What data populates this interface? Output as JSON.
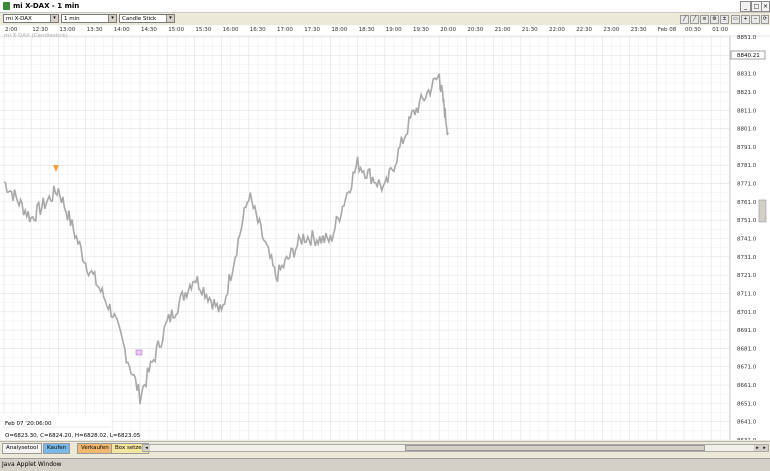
{
  "window": {
    "title": "mi X-DAX - 1 min",
    "java_status": "Java Applet Window"
  },
  "toolbar": {
    "instrument": "mi X-DAX",
    "interval": "1 min",
    "chart_type": "Candle Stick (Kerzen"
  },
  "chart": {
    "series_label": "mi X-DAX (Candlestick)",
    "last_price": "8840.21",
    "time_labels": [
      "2:00",
      "12:30",
      "13:00",
      "13:30",
      "14:00",
      "14:30",
      "15:00",
      "15:30",
      "16:00",
      "16:30",
      "17:00",
      "17:30",
      "18:00",
      "18:30",
      "19:00",
      "19:30",
      "20:00",
      "20:30",
      "21:00",
      "21:30",
      "22:00",
      "22:30",
      "23:00",
      "23:30",
      "Feb 08",
      "00:30",
      "01:00"
    ],
    "price_labels": [
      "8851.0",
      "8841.0",
      "8831.0",
      "8821.0",
      "8811.0",
      "8801.0",
      "8791.0",
      "8781.0",
      "8771.0",
      "8761.0",
      "8751.0",
      "8741.0",
      "8731.0",
      "8721.0",
      "8711.0",
      "8701.0",
      "8691.0",
      "8681.0",
      "8671.0",
      "8661.0",
      "8651.0",
      "8641.0",
      "8631.0"
    ],
    "info_date": "Feb 07 '20:06:00",
    "info_ohlc": "O=6823.30, C=6824.20, H=6828.02, L=6823.05"
  },
  "chart_data": {
    "type": "line",
    "x": [
      "12:00",
      "12:30",
      "13:00",
      "13:30",
      "14:00",
      "14:30",
      "15:00",
      "15:30",
      "16:00",
      "16:30",
      "17:00",
      "17:30",
      "18:00",
      "18:30",
      "19:00",
      "19:30",
      "20:00",
      "20:10"
    ],
    "series": [
      {
        "values": [
          8772,
          8752,
          8768,
          8728,
          8700,
          8655,
          8695,
          8720,
          8700,
          8765,
          8720,
          8742,
          8740,
          8782,
          8768,
          8808,
          8830,
          8798
        ]
      }
    ],
    "ylim": [
      8631,
      8851
    ],
    "grid": true
  },
  "bottom_tabs": {
    "analysis": "Analysetool",
    "buy": "Kaufen",
    "sell": "Verkaufen",
    "box": "Box setzen"
  },
  "colors": {
    "buy": "#7ab8e8",
    "sell": "#f2b870",
    "box": "#f3e6a0",
    "price_line": "#a8a8a8"
  }
}
